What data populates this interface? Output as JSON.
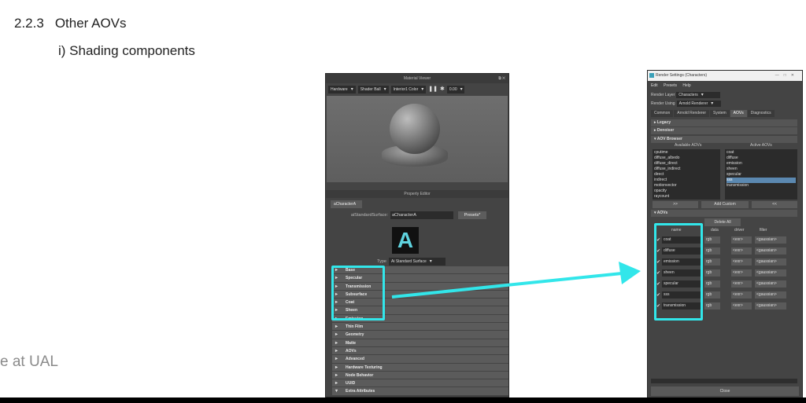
{
  "heading": {
    "number": "2.2.3",
    "title": "Other AOVs"
  },
  "subheading": "i) Shading components",
  "footer_text": "e at UAL",
  "material_viewer": {
    "title": "Material Viewer",
    "renderer": "Hardware",
    "shape": "Shader Ball",
    "environment": "Interior1 Color",
    "time": "0.00",
    "property_editor_title": "Property Editor",
    "node_tab": "aCharacterA",
    "node_type_label": "aiStandardSurface:",
    "node_name": "aCharacterA",
    "presets_label": "Presets*",
    "logo_letter": "A",
    "type_label": "Type",
    "type_value": "Ai Standard Surface",
    "sections": [
      "Base",
      "Specular",
      "Transmission",
      "Subsurface",
      "Coat",
      "Sheen",
      "Emission",
      "Thin Film",
      "Geometry",
      "Matte",
      "AOVs",
      "Advanced",
      "Hardware Texturing",
      "Node Behavior",
      "UUID",
      "Extra Attributes"
    ]
  },
  "render_settings": {
    "title": "Render Settings (Characters)",
    "menu": [
      "Edit",
      "Presets",
      "Help"
    ],
    "render_layer_label": "Render Layer",
    "render_layer_value": "Characters",
    "render_using_label": "Render Using",
    "render_using_value": "Arnold Renderer",
    "tabs": [
      "Common",
      "Arnold Renderer",
      "System",
      "AOVs",
      "Diagnostics"
    ],
    "active_tab": "AOVs",
    "bars": {
      "legacy": "Legacy",
      "denoiser": "Denoiser",
      "browser": "AOV Browser",
      "aovs": "AOVs"
    },
    "available_header": "Available AOVs",
    "active_header": "Active AOVs",
    "available": [
      "cputime",
      "diffuse_albedo",
      "diffuse_direct",
      "diffuse_indirect",
      "direct",
      "indirect",
      "motionvector",
      "opacity",
      "raycount"
    ],
    "active": [
      "coat",
      "diffuse",
      "emission",
      "sheen",
      "specular",
      "sss",
      "transmission"
    ],
    "selected_active": "sss",
    "move_right": ">>",
    "move_left": "<<",
    "add_custom": "Add Custom",
    "delete_all": "Delete All",
    "columns": {
      "name": "name",
      "data": "data",
      "driver": "driver",
      "filter": "filter"
    },
    "aov_rows": [
      {
        "name": "coat",
        "data": "rgb",
        "driver": "<exr>",
        "filter": "<gaussian>"
      },
      {
        "name": "diffuse",
        "data": "rgb",
        "driver": "<exr>",
        "filter": "<gaussian>"
      },
      {
        "name": "emission",
        "data": "rgb",
        "driver": "<exr>",
        "filter": "<gaussian>"
      },
      {
        "name": "sheen",
        "data": "rgb",
        "driver": "<exr>",
        "filter": "<gaussian>"
      },
      {
        "name": "specular",
        "data": "rgb",
        "driver": "<exr>",
        "filter": "<gaussian>"
      },
      {
        "name": "sss",
        "data": "rgb",
        "driver": "<exr>",
        "filter": "<gaussian>"
      },
      {
        "name": "transmission",
        "data": "rgb",
        "driver": "<exr>",
        "filter": "<gaussian>"
      }
    ],
    "close_label": "Close"
  },
  "highlight_color": "#32e6ea"
}
